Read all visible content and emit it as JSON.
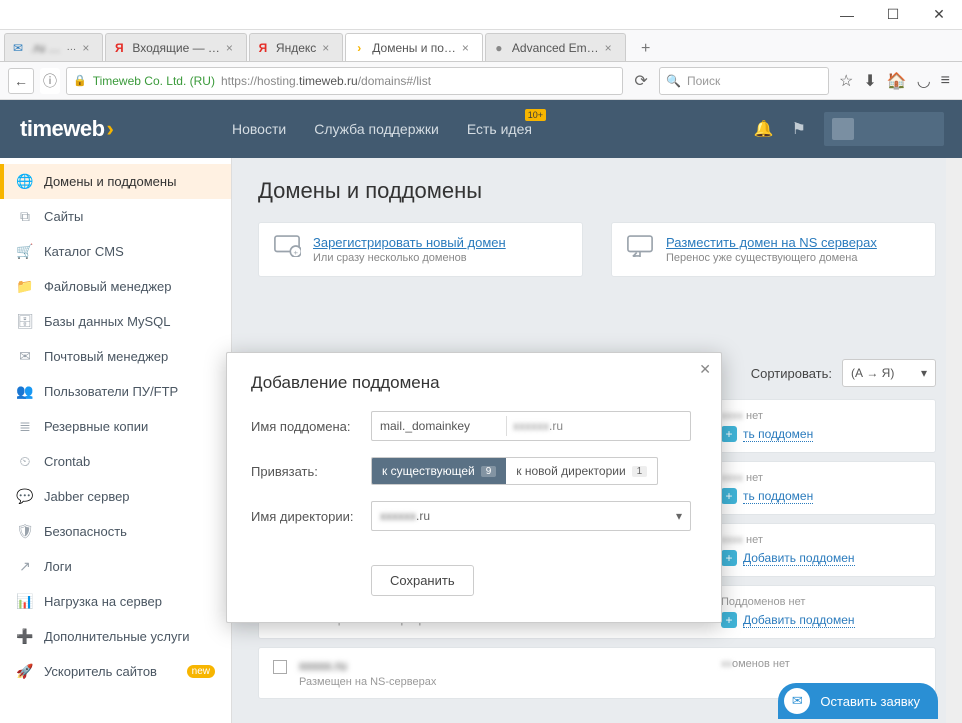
{
  "window": {
    "minimize": "—",
    "maximize": "☐",
    "close": "✕"
  },
  "tabs": [
    {
      "label": ".ru …",
      "favicon": "✉",
      "color": "#2a7bbd"
    },
    {
      "label": "Входящие — …",
      "favicon": "Я",
      "color": "#e52d27"
    },
    {
      "label": "Яндекс",
      "favicon": "Я",
      "color": "#e52d27"
    },
    {
      "label": "Домены и по…",
      "favicon": "›",
      "color": "#f7b500",
      "active": true
    },
    {
      "label": "Advanced Em…",
      "favicon": "·",
      "color": "#888"
    }
  ],
  "addr": {
    "identity": "Timeweb Co. Ltd. (RU)",
    "url": "https://hosting.timeweb.ru/domains#/list",
    "host": "timeweb.ru",
    "search_placeholder": "Поиск"
  },
  "brand": {
    "name": "timeweb"
  },
  "nav": {
    "items": [
      "Новости",
      "Служба поддержки",
      "Есть идея"
    ],
    "badge": "10+"
  },
  "sidebar": {
    "items": [
      {
        "icon": "🌐",
        "label": "Домены и поддомены",
        "active": true
      },
      {
        "icon": "⧉",
        "label": "Сайты"
      },
      {
        "icon": "🛒",
        "label": "Каталог CMS"
      },
      {
        "icon": "📁",
        "label": "Файловый менеджер"
      },
      {
        "icon": "🗄",
        "label": "Базы данных MySQL"
      },
      {
        "icon": "✉",
        "label": "Почтовый менеджер"
      },
      {
        "icon": "👥",
        "label": "Пользователи ПУ/FTP"
      },
      {
        "icon": "≣",
        "label": "Резервные копии"
      },
      {
        "icon": "⏲",
        "label": "Crontab"
      },
      {
        "icon": "💬",
        "label": "Jabber сервер"
      },
      {
        "icon": "🛡",
        "label": "Безопасность"
      },
      {
        "icon": "↗",
        "label": "Логи"
      },
      {
        "icon": "📊",
        "label": "Нагрузка на сервер"
      },
      {
        "icon": "➕",
        "label": "Дополнительные услуги"
      },
      {
        "icon": "🚀",
        "label": "Ускоритель сайтов",
        "new": "new"
      }
    ]
  },
  "main": {
    "title": "Домены и поддомены",
    "card1_link": "Зарегистрировать новый домен",
    "card1_sub": "Или сразу несколько доменов",
    "card2_link": "Разместить домен на NS серверах",
    "card2_sub": "Перенос уже существующего домена",
    "sort_label": "Сортировать:",
    "sort_value": "(А → Я)"
  },
  "domains": {
    "nosub": "Поддоменов нет",
    "hosted": "Размещен на NS-серверах",
    "addsub": "Добавить поддомен"
  },
  "modal": {
    "title": "Добавление поддомена",
    "lbl_sub": "Имя поддомена:",
    "sub_value": "mail._domainkey",
    "suffix": ".ru",
    "lbl_bind": "Привязать:",
    "opt_exist": "к существующей",
    "opt_exist_n": "9",
    "opt_new": "к новой директории",
    "opt_new_n": "1",
    "lbl_dir": "Имя директории:",
    "dir_value": ".ru",
    "save": "Сохранить"
  },
  "ticket": {
    "label": "Оставить заявку"
  }
}
